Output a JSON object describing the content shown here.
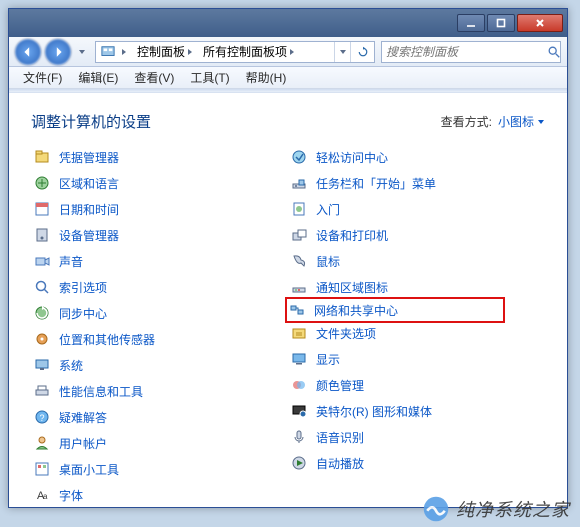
{
  "window": {
    "minimize": "—",
    "maximize": "▢",
    "close": "✕"
  },
  "address": {
    "root_icon": "control-panel-icon",
    "seg1": "控制面板",
    "seg2": "所有控制面板项"
  },
  "search": {
    "placeholder": "搜索控制面板"
  },
  "menu": {
    "file": "文件(F)",
    "edit": "编辑(E)",
    "view": "查看(V)",
    "tools": "工具(T)",
    "help": "帮助(H)"
  },
  "page": {
    "title": "调整计算机的设置",
    "viewby_label": "查看方式:",
    "viewby_value": "小图标"
  },
  "left": [
    "凭据管理器",
    "区域和语言",
    "日期和时间",
    "设备管理器",
    "声音",
    "索引选项",
    "同步中心",
    "位置和其他传感器",
    "系统",
    "性能信息和工具",
    "疑难解答",
    "用户帐户",
    "桌面小工具",
    "字体"
  ],
  "right": [
    "轻松访问中心",
    "任务栏和「开始」菜单",
    "入门",
    "设备和打印机",
    "鼠标",
    "通知区域图标",
    "网络和共享中心",
    "文件夹选项",
    "显示",
    "颜色管理",
    "英特尔(R) 图形和媒体",
    "语音识别",
    "自动播放"
  ],
  "highlight_index": 6,
  "watermark": "纯净系统之家"
}
